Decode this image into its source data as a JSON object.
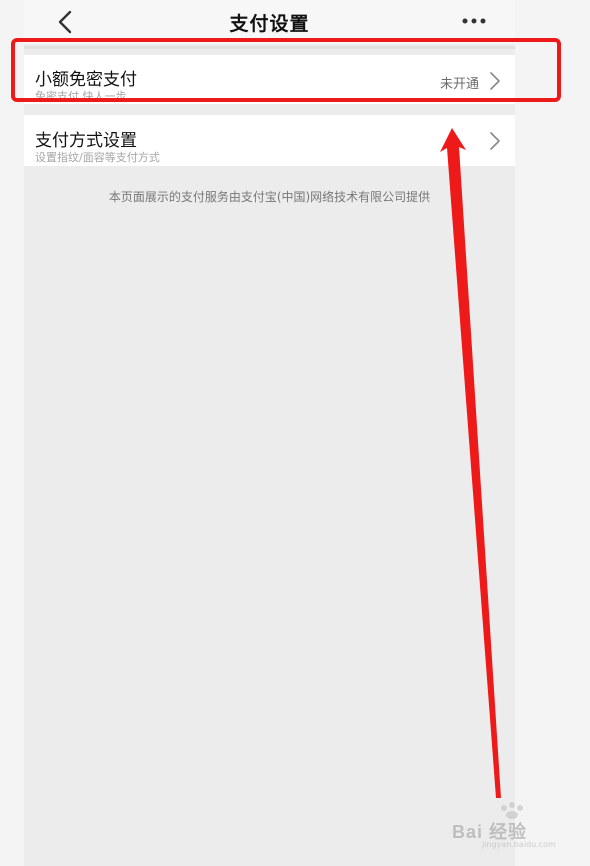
{
  "header": {
    "title": "支付设置",
    "back_icon": "chevron-left-icon",
    "more_icon": "more-horizontal-icon"
  },
  "items": [
    {
      "title": "小额免密支付",
      "subtitle": "免密支付,快人一步",
      "status": "未开通",
      "icon": "chevron-right-icon"
    },
    {
      "title": "支付方式设置",
      "subtitle": "设置指纹/面容等支付方式",
      "icon": "chevron-right-icon"
    }
  ],
  "footer_note": "本页面展示的支付服务由支付宝(中国)网络技术有限公司提供",
  "annotation": {
    "highlight_color": "#ee1a1a",
    "arrow_color": "#ee1a1a"
  },
  "watermark": {
    "text": "Bai 经验",
    "sub": "jingyan.baidu.com"
  }
}
